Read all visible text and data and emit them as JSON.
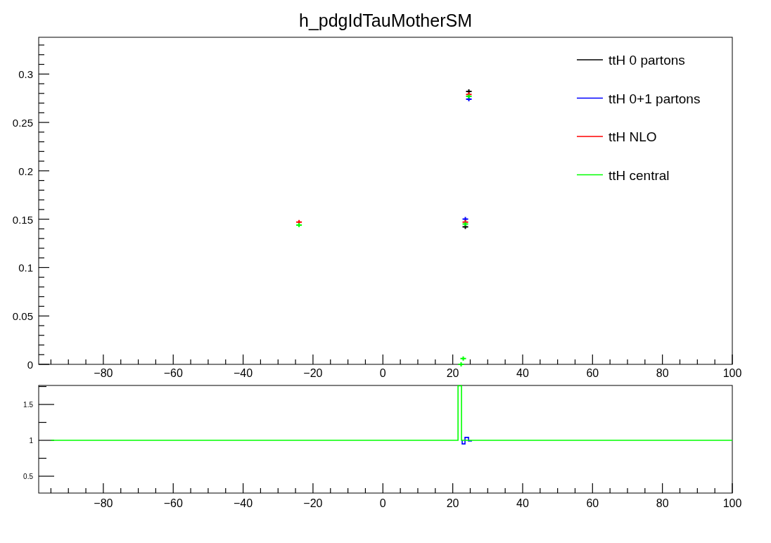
{
  "title": "h_pdgIdTauMotherSM",
  "main_plot": {
    "chart_data": {
      "type": "scatter",
      "legend": "upper right",
      "xlim": [
        -98.5,
        100
      ],
      "ylim": [
        0,
        0.338
      ],
      "x": [
        -24,
        22.4,
        23,
        23.6,
        24.6
      ],
      "xticks": [
        -80,
        -60,
        -40,
        -20,
        0,
        20,
        40,
        60,
        80,
        100
      ],
      "yticks": [
        0,
        0.05,
        0.1,
        0.15,
        0.2,
        0.25,
        0.3
      ],
      "series": [
        {
          "name": "ttH 0 partons",
          "color": "#000000",
          "values": [
            null,
            null,
            null,
            0.142,
            0.282
          ]
        },
        {
          "name": "ttH 0+1 partons",
          "color": "#0000ff",
          "values": [
            null,
            null,
            null,
            0.15,
            0.274
          ]
        },
        {
          "name": "ttH NLO",
          "color": "#ff0000",
          "values": [
            0.147,
            null,
            null,
            0.147,
            0.279
          ]
        },
        {
          "name": "ttH central",
          "color": "#00ff00",
          "values": [
            0.144,
            0.0,
            0.006,
            0.145,
            0.277
          ]
        }
      ]
    }
  },
  "ratio_plot": {
    "chart_data": {
      "type": "line",
      "xlim": [
        -98.5,
        100
      ],
      "ylim": [
        0.265,
        1.765
      ],
      "xticks": [
        -80,
        -60,
        -40,
        -20,
        0,
        20,
        40,
        60,
        80,
        100
      ],
      "yticks": [
        0.5,
        1,
        1.5
      ],
      "series": [
        {
          "color": "#0000ff",
          "x": [
            22.7,
            22.7,
            23.5,
            23.5,
            24.5,
            24.5,
            25.5
          ],
          "values": [
            1,
            0.95,
            0.95,
            1.04,
            1.04,
            0.99,
            0.99
          ]
        },
        {
          "color": "#00ff00",
          "x": [
            -95,
            21.5,
            21.5,
            22.5,
            22.5,
            100
          ],
          "values": [
            1,
            1,
            1.76,
            1.76,
            1,
            1
          ]
        }
      ]
    }
  }
}
